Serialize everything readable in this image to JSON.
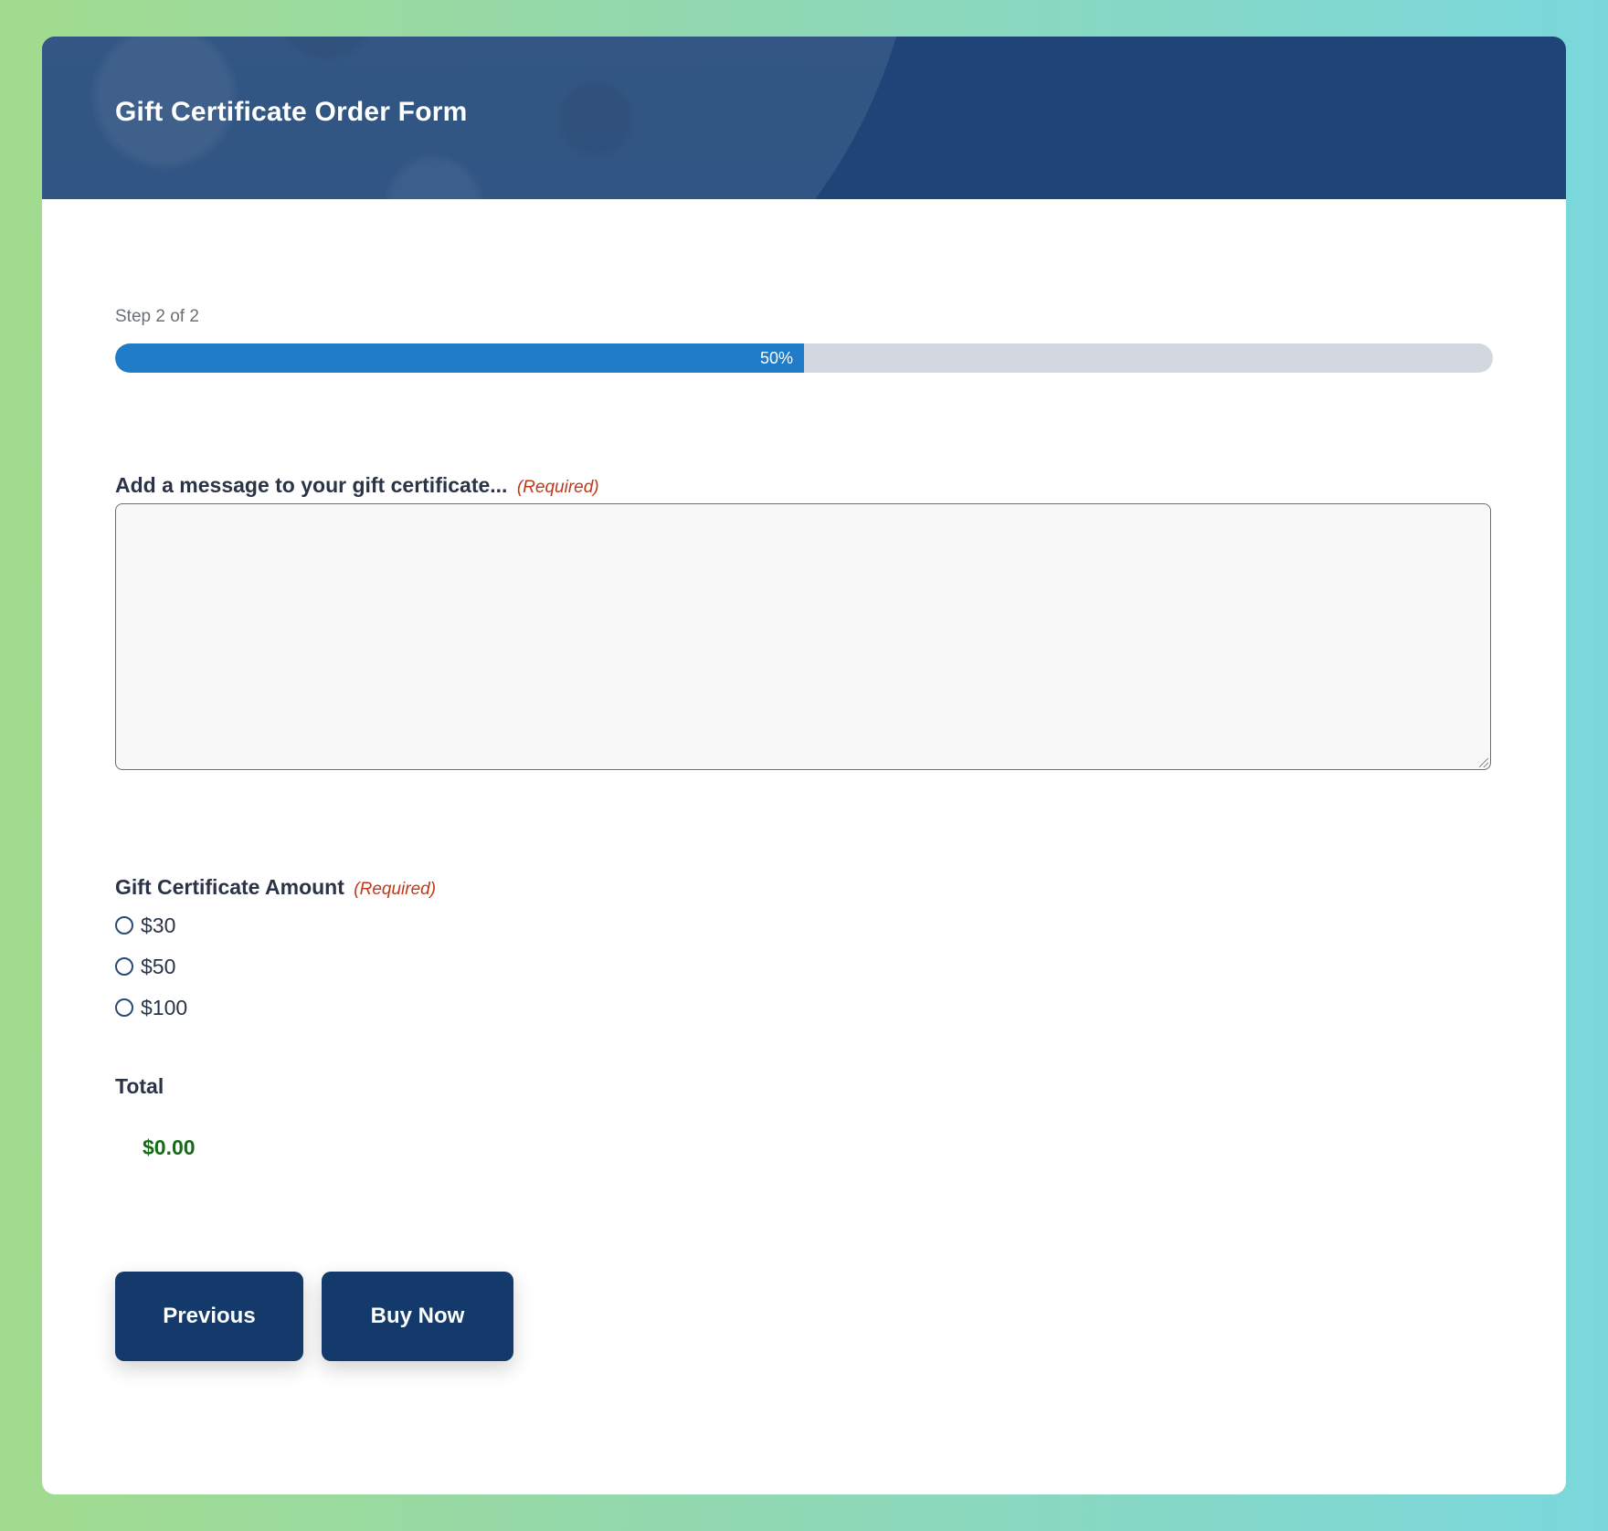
{
  "header": {
    "title": "Gift Certificate Order Form"
  },
  "progress": {
    "step_label": "Step 2 of 2",
    "percent_text": "50%",
    "percent_value": 50,
    "fill_color": "#207cc8",
    "track_color": "#d3d8e0"
  },
  "message_field": {
    "label": "Add a message to your gift certificate...",
    "required_text": "(Required)",
    "value": ""
  },
  "amount_field": {
    "label": "Gift Certificate Amount",
    "required_text": "(Required)",
    "options": [
      {
        "label": "$30",
        "selected": false
      },
      {
        "label": "$50",
        "selected": false
      },
      {
        "label": "$100",
        "selected": false
      }
    ]
  },
  "total": {
    "label": "Total",
    "value": "$0.00"
  },
  "buttons": {
    "previous": "Previous",
    "submit": "Buy Now"
  },
  "colors": {
    "header_bg": "#1e4478",
    "button_bg": "#133a6b",
    "required": "#c0381a",
    "total_value": "#156b16",
    "background_gradient_start": "#a1db8d",
    "background_gradient_end": "#79d7dc"
  }
}
